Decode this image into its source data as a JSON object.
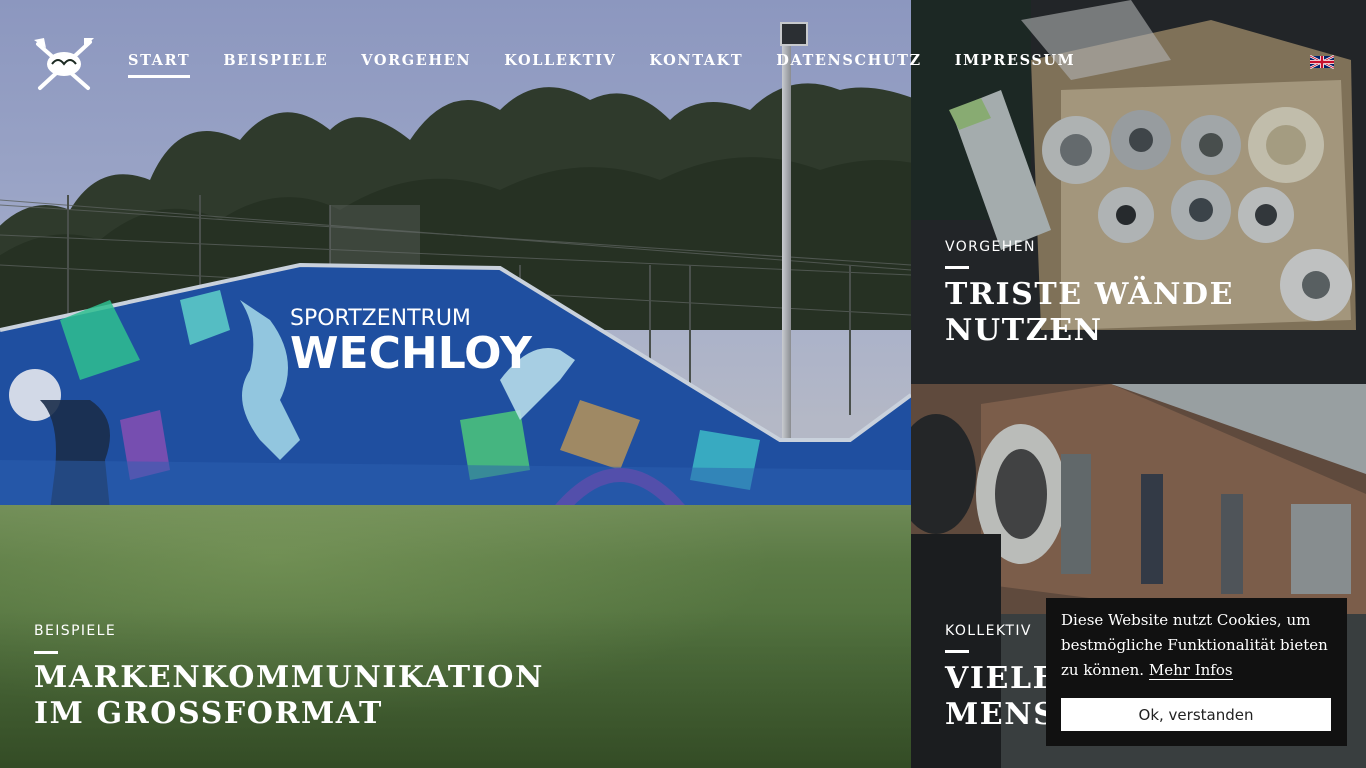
{
  "nav": {
    "items": [
      {
        "label": "START",
        "active": true
      },
      {
        "label": "BEISPIELE",
        "active": false
      },
      {
        "label": "VORGEHEN",
        "active": false
      },
      {
        "label": "KOLLEKTIV",
        "active": false
      },
      {
        "label": "KONTAKT",
        "active": false
      },
      {
        "label": "DATENSCHUTZ",
        "active": false
      },
      {
        "label": "IMPRESSUM",
        "active": false
      }
    ],
    "language_flag": "uk-flag-icon"
  },
  "logo": {
    "icon": "crossed-brushes-logo-icon"
  },
  "hero": {
    "mural_text_line1": "SPORTZENTRUM",
    "mural_text_line2": "WECHLOY",
    "kicker": "BEISPIELE",
    "title_line1": "MARKENKOMMUNIKATION",
    "title_line2": "IM GROSSFORMAT"
  },
  "tiles": [
    {
      "kicker": "VORGEHEN",
      "title_line1": "TRISTE WÄNDE",
      "title_line2": "NUTZEN"
    },
    {
      "kicker": "KOLLEKTIV",
      "title_line1": "VIELF",
      "title_line2": "MENS"
    }
  ],
  "cookie": {
    "text": "Diese Website nutzt Cookies, um bestmögliche Funktionalität bieten zu können.",
    "link": "Mehr Infos",
    "button": "Ok, verstanden"
  },
  "colors": {
    "mural_blue": "#1f4fa0",
    "mural_teal": "#3ec1c9",
    "mural_green": "#4cc77a",
    "grass": "#5b7a45",
    "cookie_bg": "#111111"
  }
}
